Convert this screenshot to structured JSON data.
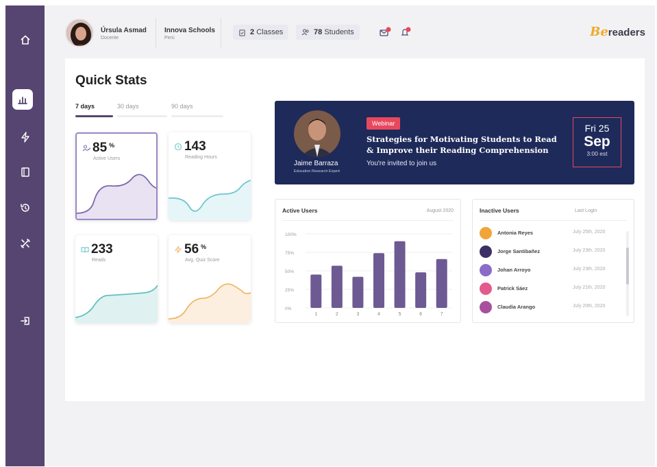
{
  "app": {
    "brand_prefix": "Be",
    "brand_suffix": "readers"
  },
  "sidebar": {
    "items": [
      {
        "name": "home",
        "icon": "home-icon",
        "active": false
      },
      {
        "name": "stats",
        "icon": "bar-chart-icon",
        "active": true
      },
      {
        "name": "activity",
        "icon": "lightning-icon",
        "active": false
      },
      {
        "name": "books",
        "icon": "book-icon",
        "active": false
      },
      {
        "name": "history",
        "icon": "history-icon",
        "active": false
      },
      {
        "name": "tools",
        "icon": "tools-icon",
        "active": false
      },
      {
        "name": "logout",
        "icon": "logout-icon",
        "active": false
      }
    ]
  },
  "header": {
    "user_name": "Úrsula Asmad",
    "user_role": "Docente",
    "school_name": "Innova Schools",
    "school_location": "Perú",
    "classes_count": "2",
    "classes_label": "Classes",
    "students_count": "78",
    "students_label": "Students"
  },
  "quick_stats": {
    "title": "Quick Stats",
    "tabs": [
      {
        "label": "7 days",
        "active": true
      },
      {
        "label": "30 days",
        "active": false
      },
      {
        "label": "90 days",
        "active": false
      }
    ],
    "stats": [
      {
        "value": "85",
        "unit": "%",
        "label": "Active Users",
        "icon": "users-icon",
        "color": "#7d6aa8",
        "fill": "#e8e2f3"
      },
      {
        "value": "143",
        "unit": "",
        "label": "Reading Hours",
        "icon": "clock-icon",
        "color": "#6cc6d2",
        "fill": "#e6f5f7"
      },
      {
        "value": "233",
        "unit": "",
        "label": "Reads",
        "icon": "book-open-icon",
        "color": "#5fc2c0",
        "fill": "#dff2f1"
      },
      {
        "value": "56",
        "unit": "%",
        "label": "Avg. Quiz Score",
        "icon": "lightning-icon",
        "color": "#f0b768",
        "fill": "#fcefdf"
      }
    ]
  },
  "webinar": {
    "badge": "Webinar",
    "title": "Strategies for Motivating Students to Read & Improve their Reading Comprehension",
    "subtitle": "You're invited to join us",
    "presenter_name": "Jaime Barraza",
    "presenter_role": "Education Research Expert",
    "date_day": "Fri 25",
    "date_month": "Sep",
    "date_time": "3:00 est"
  },
  "active_users_card": {
    "title": "Active Users",
    "period": "August 2020"
  },
  "chart_data": {
    "type": "bar",
    "title": "Active Users",
    "categories": [
      "1",
      "2",
      "3",
      "4",
      "5",
      "6",
      "7"
    ],
    "values": [
      45,
      57,
      42,
      74,
      90,
      48,
      66
    ],
    "ylim": [
      0,
      100
    ],
    "yticks": [
      "0%",
      "25%",
      "50%",
      "75%",
      "100%"
    ],
    "grid": true,
    "bar_color": "#6d5a92"
  },
  "inactive_users": {
    "title": "Inactive Users",
    "column_label": "Last Login",
    "rows": [
      {
        "name": "Antonia Reyes",
        "last_login": "July 25th, 2020",
        "color": "#f0a43a"
      },
      {
        "name": "Jorge Santibañez",
        "last_login": "July 23th, 2020",
        "color": "#3b2f66"
      },
      {
        "name": "Johan Arroyo",
        "last_login": "July 23th, 2020",
        "color": "#8a6cc8"
      },
      {
        "name": "Patrick Sáez",
        "last_login": "July 21th, 2020",
        "color": "#e45a8c"
      },
      {
        "name": "Claudia Arango",
        "last_login": "July 20th, 2020",
        "color": "#a84f9e"
      }
    ]
  }
}
